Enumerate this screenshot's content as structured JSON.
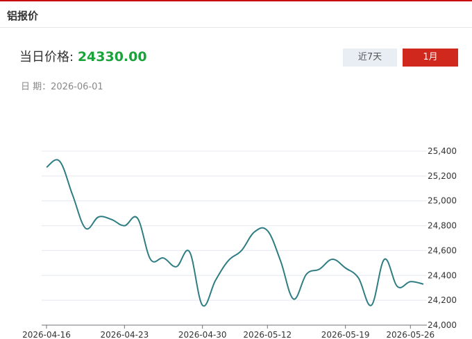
{
  "header": {
    "title": "铝报价"
  },
  "price": {
    "label": "当日价格",
    "colon": ":",
    "value": "24330.00"
  },
  "date": {
    "label": "日 期：",
    "value": "2026-06-01"
  },
  "buttons": {
    "week": "近7天",
    "month": "1月"
  },
  "colors": {
    "accent": "#c7000b",
    "price": "#1aa33b",
    "line": "#2e7d82",
    "active_button": "#d0281d"
  },
  "chart_data": {
    "type": "line",
    "x_tick_labels": [
      "2026-04-16",
      "2026-04-23",
      "2026-04-30",
      "2026-05-12",
      "2026-05-19",
      "2026-05-26"
    ],
    "y_tick_labels": [
      "24,000",
      "24,200",
      "24,400",
      "24,600",
      "24,800",
      "25,000",
      "25,200",
      "25,400"
    ],
    "ylim": [
      24000,
      25400
    ],
    "y_ticks": [
      24000,
      24200,
      24400,
      24600,
      24800,
      25000,
      25200,
      25400
    ],
    "grid": true,
    "y_axis_side": "right",
    "series": [
      {
        "values": [
          25270,
          25320,
          25050,
          24780,
          24870,
          24850,
          24800,
          24860,
          24530,
          24540,
          24470,
          24590,
          24160,
          24360,
          24520,
          24600,
          24750,
          24760,
          24520,
          24210,
          24410,
          24450,
          24530,
          24460,
          24380,
          24160,
          24530,
          24310,
          24350,
          24330
        ]
      }
    ]
  }
}
